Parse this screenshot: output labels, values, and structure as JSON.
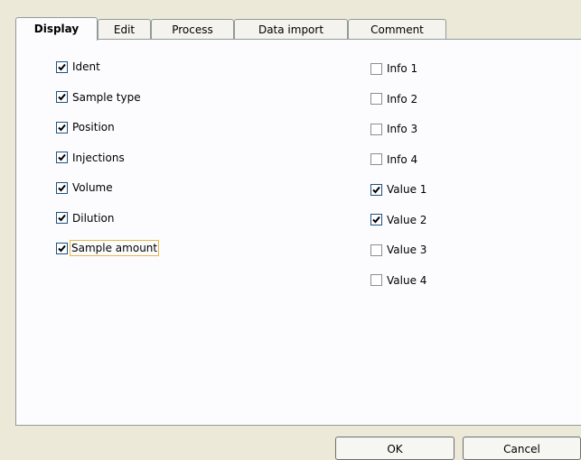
{
  "tabs": [
    {
      "label": "Display",
      "active": true
    },
    {
      "label": "Edit",
      "active": false
    },
    {
      "label": "Process",
      "active": false
    },
    {
      "label": "Data import",
      "active": false
    },
    {
      "label": "Comment",
      "active": false
    }
  ],
  "left_options": [
    {
      "label": "Ident",
      "checked": true
    },
    {
      "label": "Sample type",
      "checked": true
    },
    {
      "label": "Position",
      "checked": true
    },
    {
      "label": "Injections",
      "checked": true
    },
    {
      "label": "Volume",
      "checked": true
    },
    {
      "label": "Dilution",
      "checked": true
    },
    {
      "label": "Sample amount",
      "checked": true,
      "focused": true
    }
  ],
  "right_options": [
    {
      "label": "Info 1",
      "checked": false
    },
    {
      "label": "Info 2",
      "checked": false
    },
    {
      "label": "Info 3",
      "checked": false
    },
    {
      "label": "Info 4",
      "checked": false
    },
    {
      "label": "Value 1",
      "checked": true
    },
    {
      "label": "Value 2",
      "checked": true
    },
    {
      "label": "Value 3",
      "checked": false
    },
    {
      "label": "Value 4",
      "checked": false
    }
  ],
  "buttons": {
    "ok": "OK",
    "cancel": "Cancel"
  }
}
